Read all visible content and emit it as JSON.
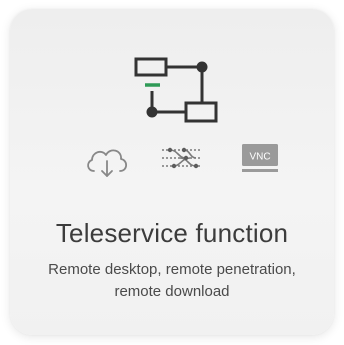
{
  "card": {
    "title": "Teleservice function",
    "description": "Remote desktop, remote penetration, remote download"
  },
  "icons": {
    "hero": "network-topology-icon",
    "download": "cloud-download-icon",
    "penetration": "network-penetration-icon",
    "vnc": "vnc-monitor-icon",
    "vnc_label": "VNC"
  },
  "colors": {
    "accent": "#2e9a56",
    "icon_stroke": "#333333",
    "icon_light": "#8a8a8a"
  }
}
